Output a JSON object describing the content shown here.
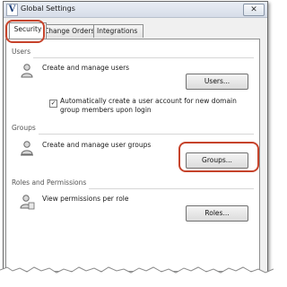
{
  "window": {
    "title": "Global Settings",
    "close_glyph": "✕",
    "app_icon_letter": "V"
  },
  "tabs": [
    {
      "label": "Security",
      "active": true
    },
    {
      "label": "Change Orders",
      "active": false
    },
    {
      "label": "Integrations",
      "active": false
    }
  ],
  "sections": {
    "users": {
      "title": "Users",
      "description": "Create and manage users",
      "button": "Users...",
      "checkbox": {
        "checked": true,
        "label": "Automatically create a user account for new domain group members upon login"
      },
      "icon": "user-icon"
    },
    "groups": {
      "title": "Groups",
      "description": "Create and manage user groups",
      "button": "Groups...",
      "icon": "user-group-icon"
    },
    "roles": {
      "title": "Roles and Permissions",
      "description": "View permissions per role",
      "button": "Roles...",
      "icon": "user-roles-icon"
    }
  },
  "colors": {
    "annotation_red": "#c6432b"
  }
}
